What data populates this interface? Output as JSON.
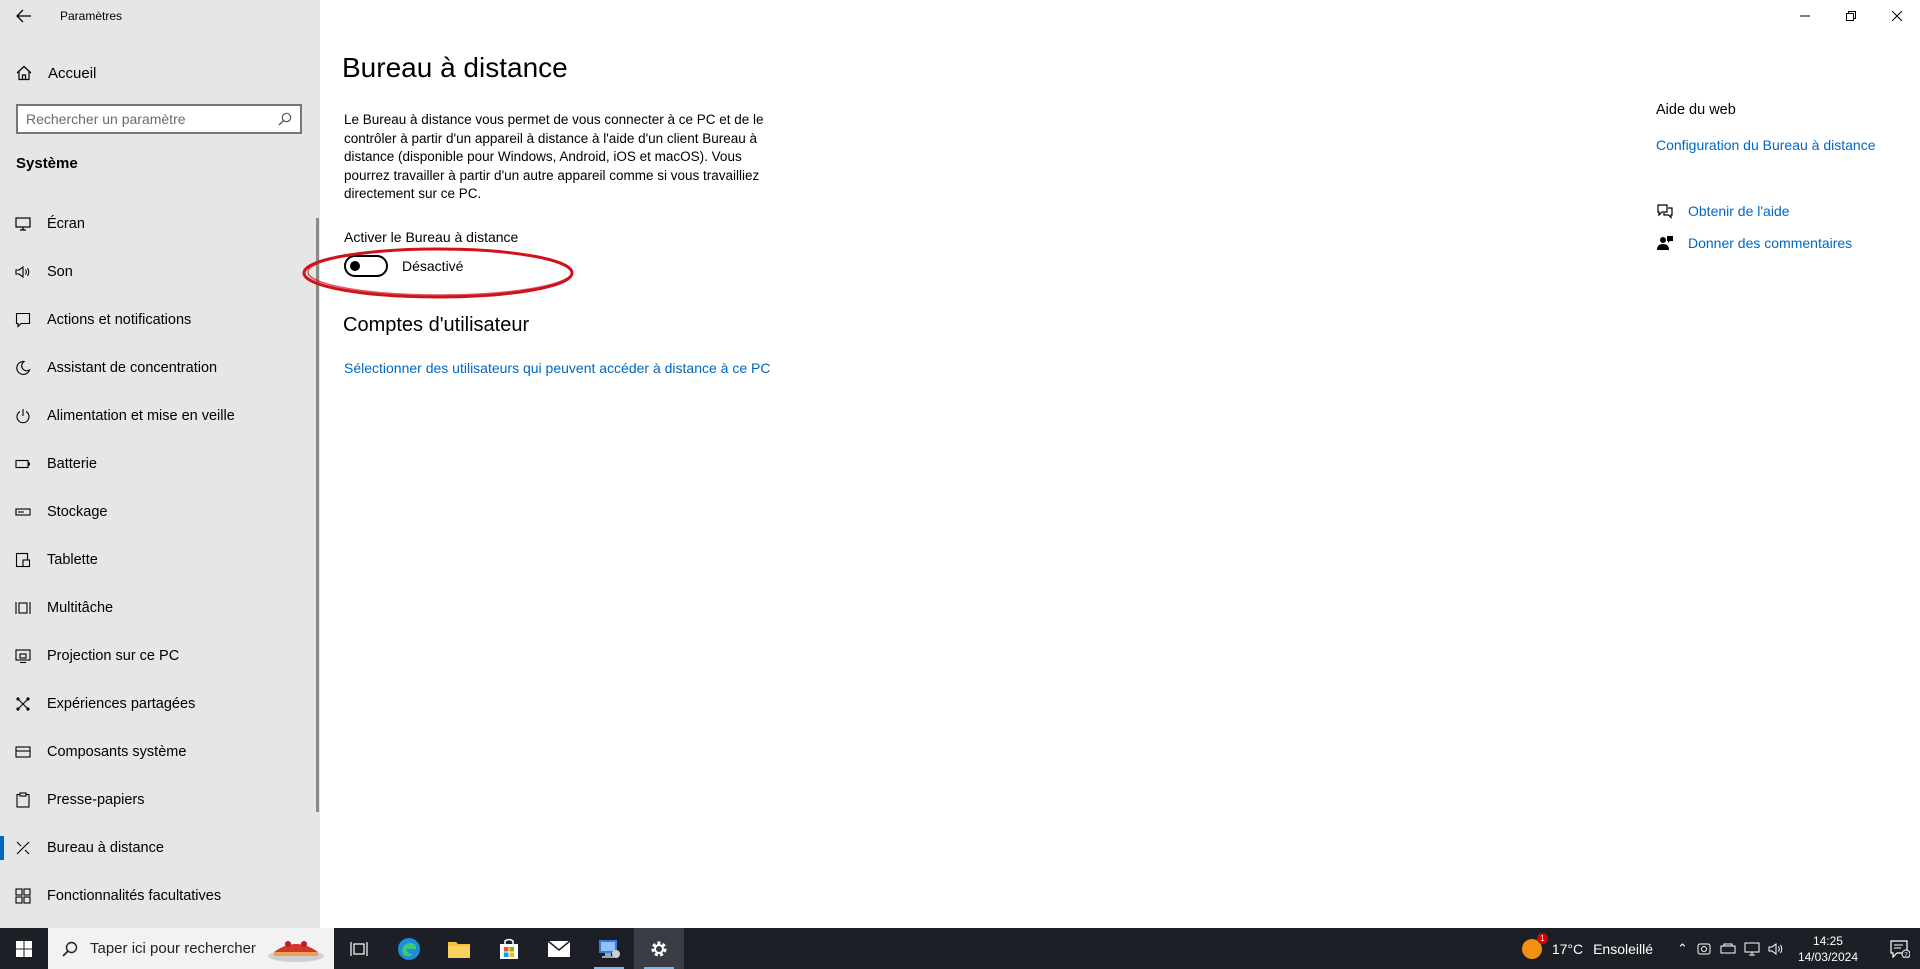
{
  "window": {
    "title": "Paramètres"
  },
  "sidebar": {
    "home_label": "Accueil",
    "search_placeholder": "Rechercher un paramètre",
    "section_title": "Système",
    "items": [
      {
        "label": "Écran",
        "icon": "monitor-icon"
      },
      {
        "label": "Son",
        "icon": "speaker-icon"
      },
      {
        "label": "Actions et notifications",
        "icon": "notification-icon"
      },
      {
        "label": "Assistant de concentration",
        "icon": "moon-icon"
      },
      {
        "label": "Alimentation et mise en veille",
        "icon": "power-icon"
      },
      {
        "label": "Batterie",
        "icon": "battery-icon"
      },
      {
        "label": "Stockage",
        "icon": "storage-icon"
      },
      {
        "label": "Tablette",
        "icon": "tablet-icon"
      },
      {
        "label": "Multitâche",
        "icon": "multitask-icon"
      },
      {
        "label": "Projection sur ce PC",
        "icon": "projection-icon"
      },
      {
        "label": "Expériences partagées",
        "icon": "shared-icon"
      },
      {
        "label": "Composants système",
        "icon": "components-icon"
      },
      {
        "label": "Presse-papiers",
        "icon": "clipboard-icon"
      },
      {
        "label": "Bureau à distance",
        "icon": "remote-desktop-icon",
        "selected": true
      },
      {
        "label": "Fonctionnalités facultatives",
        "icon": "optional-features-icon"
      }
    ]
  },
  "main": {
    "title": "Bureau à distance",
    "description": "Le Bureau à distance vous permet de vous connecter à ce PC et de le contrôler à partir d'un appareil à distance à l'aide d'un client Bureau à distance (disponible pour Windows, Android, iOS et macOS). Vous pourrez travailler à partir d'un autre appareil comme si vous travailliez directement sur ce PC.",
    "toggle_label": "Activer le Bureau à distance",
    "toggle_state": "Désactivé",
    "toggle_on": false,
    "accounts_title": "Comptes d'utilisateur",
    "accounts_link": "Sélectionner des utilisateurs qui peuvent accéder à distance à ce PC"
  },
  "aside": {
    "web_help_title": "Aide du web",
    "config_link": "Configuration du Bureau à distance",
    "get_help": "Obtenir de l'aide",
    "feedback": "Donner des commentaires"
  },
  "taskbar": {
    "search_placeholder": "Taper ici pour rechercher",
    "weather_temp": "17°C",
    "weather_desc": "Ensoleillé",
    "weather_badge": "1",
    "time": "14:25",
    "date": "14/03/2024",
    "notif_count": "2"
  },
  "colors": {
    "accent": "#0067c0",
    "sidebar_bg": "#e6e6e6",
    "annotation": "#d0121b",
    "taskbar_bg": "#1c1f26"
  }
}
